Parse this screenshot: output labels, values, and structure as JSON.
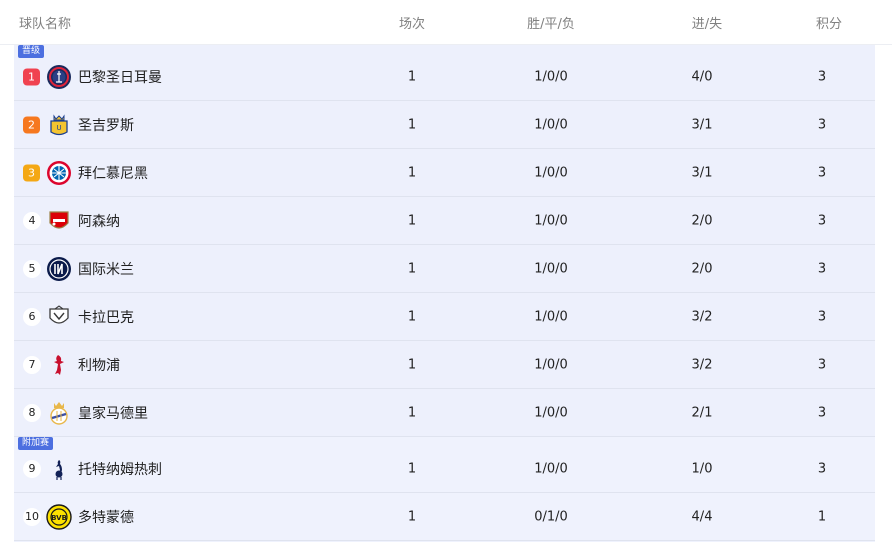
{
  "header": {
    "team": "球队名称",
    "played": "场次",
    "wdl": "胜/平/负",
    "goals": "进/失",
    "points": "积分"
  },
  "groups": {
    "promo": "晋级",
    "playoff": "附加赛"
  },
  "colors": {
    "rank1": "#f04250",
    "rank2": "#f6781f",
    "rank3": "#f4a815",
    "group_band": "#edf0fc",
    "group_label": "#4c6fe0"
  },
  "rows": [
    {
      "rank": "1",
      "team": "巴黎圣日耳曼",
      "played": "1",
      "wdl": "1/0/0",
      "goals": "4/0",
      "points": "3",
      "crest": "psg-crest-icon"
    },
    {
      "rank": "2",
      "team": "圣吉罗斯",
      "played": "1",
      "wdl": "1/0/0",
      "goals": "3/1",
      "points": "3",
      "crest": "union-sg-crest-icon"
    },
    {
      "rank": "3",
      "team": "拜仁慕尼黑",
      "played": "1",
      "wdl": "1/0/0",
      "goals": "3/1",
      "points": "3",
      "crest": "bayern-crest-icon"
    },
    {
      "rank": "4",
      "team": "阿森纳",
      "played": "1",
      "wdl": "1/0/0",
      "goals": "2/0",
      "points": "3",
      "crest": "arsenal-crest-icon"
    },
    {
      "rank": "5",
      "team": "国际米兰",
      "played": "1",
      "wdl": "1/0/0",
      "goals": "2/0",
      "points": "3",
      "crest": "inter-crest-icon"
    },
    {
      "rank": "6",
      "team": "卡拉巴克",
      "played": "1",
      "wdl": "1/0/0",
      "goals": "3/2",
      "points": "3",
      "crest": "qarabag-crest-icon"
    },
    {
      "rank": "7",
      "team": "利物浦",
      "played": "1",
      "wdl": "1/0/0",
      "goals": "3/2",
      "points": "3",
      "crest": "liverpool-crest-icon"
    },
    {
      "rank": "8",
      "team": "皇家马德里",
      "played": "1",
      "wdl": "1/0/0",
      "goals": "2/1",
      "points": "3",
      "crest": "real-madrid-crest-icon"
    },
    {
      "rank": "9",
      "team": "托特纳姆热刺",
      "played": "1",
      "wdl": "1/0/0",
      "goals": "1/0",
      "points": "3",
      "crest": "tottenham-crest-icon"
    },
    {
      "rank": "10",
      "team": "多特蒙德",
      "played": "1",
      "wdl": "0/1/0",
      "goals": "4/4",
      "points": "1",
      "crest": "dortmund-crest-icon"
    }
  ]
}
